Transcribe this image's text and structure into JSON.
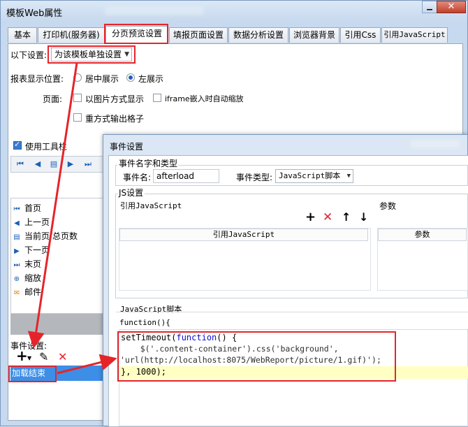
{
  "window": {
    "title": "模板Web属性",
    "min_label": "▁",
    "close_label": "✕"
  },
  "tabs": [
    "基本",
    "打印机(服务器)",
    "分页预览设置",
    "填报页面设置",
    "数据分析设置",
    "浏览器背景",
    "引用Css",
    "引用JavaScript"
  ],
  "active_tab": 2,
  "settings": {
    "scope_label": "以下设置:",
    "scope_value": "为该模板单独设置",
    "position_label": "报表显示位置:",
    "position_opt_center": "居中展示",
    "position_opt_left": "左展示",
    "page_label": "页面:",
    "opt_image": "以图片方式显示",
    "opt_iframe": "iframe嵌入时自动缩放",
    "opt_repeat": "重方式输出格子",
    "toolbar_label": "使用工具栏"
  },
  "toolbar_list": [
    "首页",
    "上一页",
    "当前页/总页数",
    "下一页",
    "末页",
    "缩放",
    "邮件"
  ],
  "events": {
    "label": "事件设置:",
    "item": "加载结束",
    "add": "+",
    "edit": "✎",
    "delete": "✕"
  },
  "dialog": {
    "title": "事件设置",
    "group_name_type": "事件名字和类型",
    "name_label": "事件名:",
    "name_value": "afterload",
    "type_label": "事件类型:",
    "type_value": "JavaScript脚本",
    "group_js": "JS设置",
    "ref_js_label": "引用JavaScript",
    "params_label": "参数",
    "col_ref_js": "引用JavaScript",
    "col_params": "参数",
    "script_label": "JavaScript脚本",
    "fn_header": "function(){",
    "code": {
      "line1_a": "setTimeout(",
      "line1_kw": "function",
      "line1_b": "() {",
      "line2": "    $('.content-container').css('background',",
      "line3": "'url(http://localhost:8075/WebReport/picture/1.gif)');",
      "line4": "}, 1000);"
    },
    "tools": {
      "add": "+",
      "delete": "✕",
      "up": "↑",
      "down": "↓"
    }
  },
  "colors": {
    "highlight_red": "#e5242a",
    "selection_blue": "#3d8ee6",
    "code_highlight": "#ffffc4"
  }
}
